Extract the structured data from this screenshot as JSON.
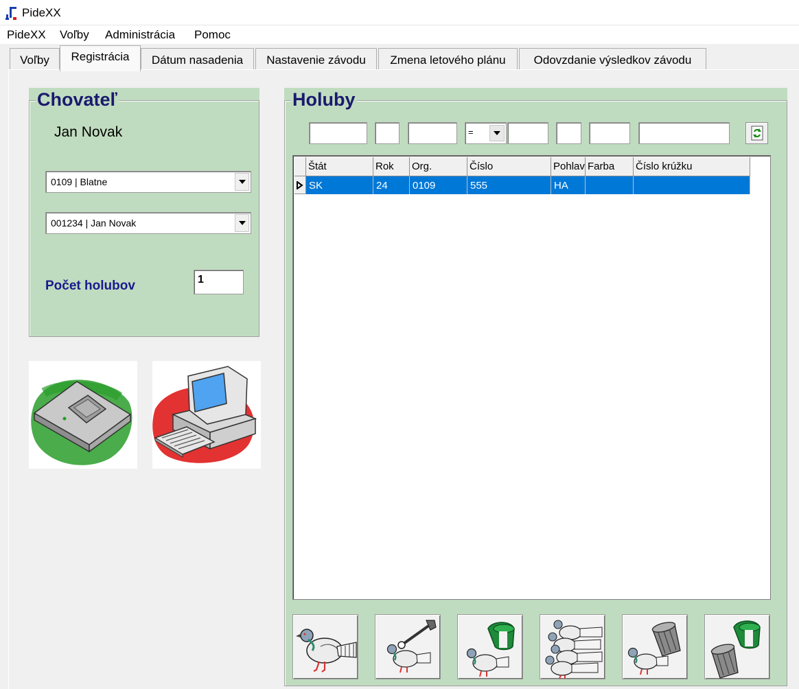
{
  "window": {
    "title": "PideXX"
  },
  "menu": [
    "PideXX",
    "Voľby",
    "Administrácia",
    "Pomoc"
  ],
  "tabs": [
    "Voľby",
    "Registrácia",
    "Dátum nasadenia",
    "Nastavenie závodu",
    "Zmena letového plánu",
    "Odovzdanie výsledkov závodu"
  ],
  "active_tab": "Registrácia",
  "breeder": {
    "title": "Chovateľ",
    "name": "Jan Novak",
    "org_combo": "0109 | Blatne",
    "breeder_combo": "001234 | Jan Novak",
    "count_label": "Počet holubov",
    "count_value": "1"
  },
  "pigeons": {
    "title": "Holuby",
    "filter": {
      "operator": "="
    },
    "columns": [
      "Štát",
      "Rok",
      "Org.",
      "Číslo",
      "Pohlavie",
      "Farba",
      "Číslo krúžku"
    ],
    "rows": [
      {
        "stat": "SK",
        "rok": "24",
        "org": "0109",
        "cislo": "555",
        "pohlavie": "HA",
        "farba": "",
        "kruzok": ""
      }
    ]
  },
  "icons": {
    "usb_reader": "usb-reader-icon",
    "computer": "computer-icon",
    "add": "add-pigeon-icon",
    "edit": "edit-pigeon-icon",
    "ring": "ring-pigeon-icon",
    "add_many": "add-many-pigeons-icon",
    "delete": "delete-pigeon-icon",
    "delete_ring": "delete-ring-icon",
    "refresh": "refresh-icon"
  },
  "colors": {
    "panel": "#c0dcc0",
    "selection": "#0078d7",
    "heading": "#1a1a6e"
  }
}
